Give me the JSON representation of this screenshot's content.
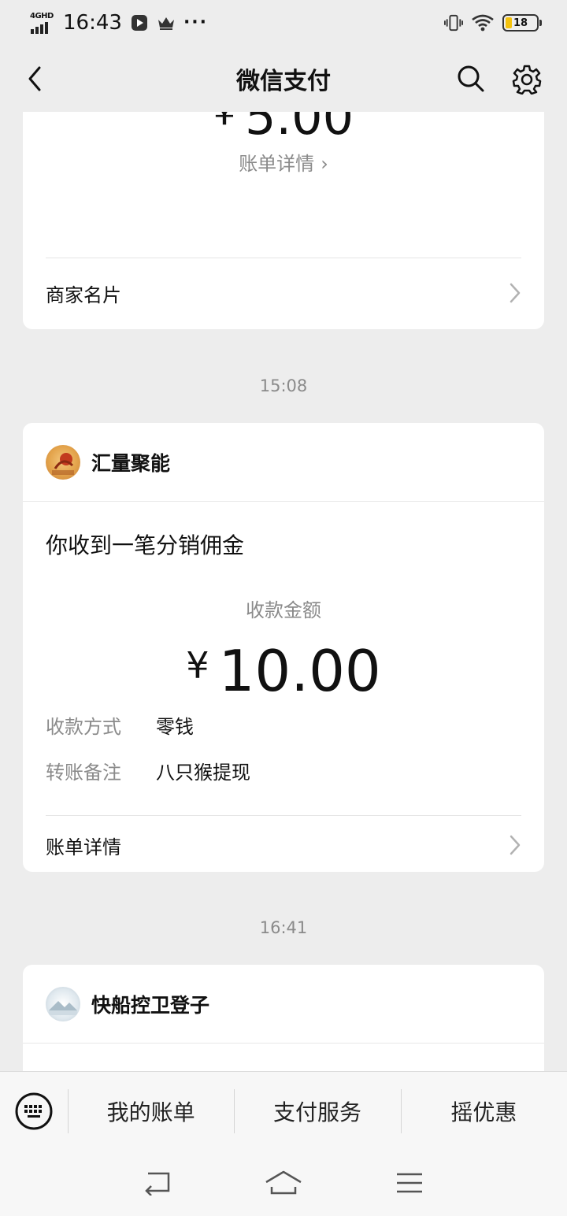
{
  "status_bar": {
    "network": "4GHD",
    "time": "16:43",
    "battery": "18",
    "more": "···"
  },
  "nav": {
    "title": "微信支付"
  },
  "card_top": {
    "currency": "¥",
    "amount": "5.00",
    "detail_link": "账单详情",
    "merchant_card": "商家名片"
  },
  "timestamps": [
    "15:08",
    "16:41"
  ],
  "card_commission": {
    "merchant": "汇量聚能",
    "message_title": "你收到一笔分销佣金",
    "amount_label": "收款金额",
    "currency": "¥",
    "amount": "10.00",
    "method_label": "收款方式",
    "method_value": "零钱",
    "remark_label": "转账备注",
    "remark_value": "八只猴提现",
    "detail_link": "账单详情"
  },
  "card_next": {
    "merchant": "快船控卫登子"
  },
  "bottom_menu": {
    "items": [
      "我的账单",
      "支付服务",
      "摇优惠"
    ]
  },
  "colors": {
    "background": "#ededed",
    "card": "#ffffff",
    "muted_text": "#8a8a8a",
    "battery_fill": "#f4c20d"
  },
  "icons": [
    "keyboard-icon",
    "back-icon",
    "search-icon",
    "gear-icon",
    "chevron-right-icon",
    "vibrate-icon",
    "wifi-icon",
    "battery-icon"
  ]
}
